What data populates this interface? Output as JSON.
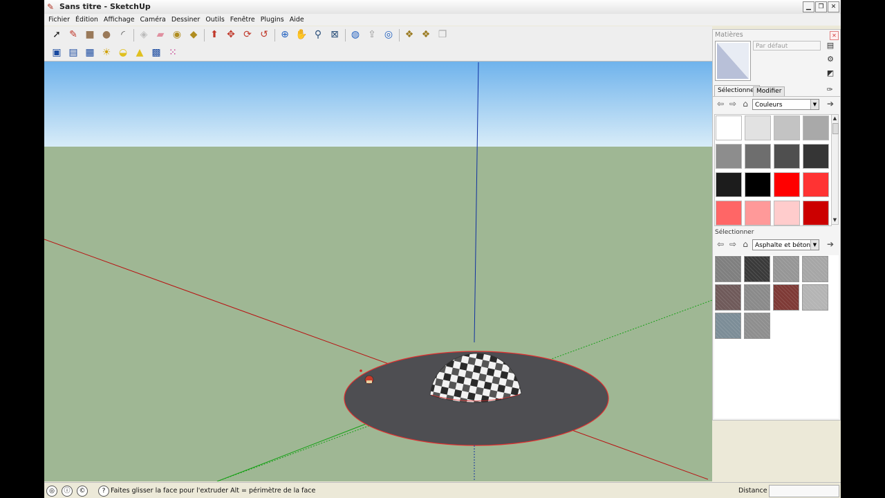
{
  "window": {
    "title": "Sans titre - SketchUp",
    "controls": [
      "minimize-icon",
      "maximize-icon",
      "close-icon"
    ]
  },
  "menu": [
    "Fichier",
    "Édition",
    "Affichage",
    "Caméra",
    "Dessiner",
    "Outils",
    "Fenêtre",
    "Plugins",
    "Aide"
  ],
  "toolbar1": [
    {
      "name": "select-tool-icon",
      "glyph": "➚",
      "color": "#222222"
    },
    {
      "name": "pencil-tool-icon",
      "glyph": "✎",
      "color": "#c0392b"
    },
    {
      "name": "rectangle-tool-icon",
      "glyph": "■",
      "color": "#9a7a5a"
    },
    {
      "name": "circle-tool-icon",
      "glyph": "●",
      "color": "#9a7a5a"
    },
    {
      "name": "arc-tool-icon",
      "glyph": "◜",
      "color": "#444444"
    },
    {
      "name": "make-component-icon",
      "glyph": "◈",
      "color": "#bbbbbb"
    },
    {
      "name": "eraser-tool-icon",
      "glyph": "▰",
      "color": "#e090a0"
    },
    {
      "name": "tape-measure-icon",
      "glyph": "◉",
      "color": "#b08d20"
    },
    {
      "name": "paint-bucket-icon",
      "glyph": "◆",
      "color": "#b08d20"
    },
    {
      "name": "push-pull-icon",
      "glyph": "⬆",
      "color": "#c0392b"
    },
    {
      "name": "move-tool-icon",
      "glyph": "✥",
      "color": "#c0392b"
    },
    {
      "name": "rotate-tool-icon",
      "glyph": "⟳",
      "color": "#c0392b"
    },
    {
      "name": "offset-tool-icon",
      "glyph": "↺",
      "color": "#c0392b"
    },
    {
      "name": "orbit-tool-icon",
      "glyph": "⊕",
      "color": "#2060c0"
    },
    {
      "name": "pan-tool-icon",
      "glyph": "✋",
      "color": "#555555"
    },
    {
      "name": "zoom-tool-icon",
      "glyph": "⚲",
      "color": "#2a4f7a"
    },
    {
      "name": "zoom-extents-icon",
      "glyph": "⊠",
      "color": "#2a4f7a"
    },
    {
      "name": "3d-warehouse-icon",
      "glyph": "◍",
      "color": "#2060c0"
    },
    {
      "name": "share-model-icon",
      "glyph": "⇪",
      "color": "#9a9a9a"
    },
    {
      "name": "get-models-icon",
      "glyph": "◎",
      "color": "#2060c0"
    },
    {
      "name": "component-icon",
      "glyph": "❖",
      "color": "#9a7a20"
    },
    {
      "name": "component-options-icon",
      "glyph": "❖",
      "color": "#9a7a20"
    },
    {
      "name": "share-component-icon",
      "glyph": "❐",
      "color": "#aaaaaa"
    }
  ],
  "toolbar2": [
    {
      "name": "layers-icon",
      "glyph": "▣",
      "color": "#1a4aa0"
    },
    {
      "name": "outliner-icon",
      "glyph": "▤",
      "color": "#1a4aa0"
    },
    {
      "name": "scenes-icon",
      "glyph": "▦",
      "color": "#1a4aa0"
    },
    {
      "name": "shadow-settings-icon",
      "glyph": "☀",
      "color": "#d0a000"
    },
    {
      "name": "shadows-toggle-icon",
      "glyph": "◒",
      "color": "#e0c020"
    },
    {
      "name": "fog-icon",
      "glyph": "▲",
      "color": "#e0c020"
    },
    {
      "name": "styles-icon",
      "glyph": "▩",
      "color": "#1a4aa0"
    },
    {
      "name": "materials-grid-icon",
      "glyph": "⁙",
      "color": "#c02080"
    }
  ],
  "materials_panel": {
    "title": "Matières",
    "name_placeholder": "Par défaut",
    "tab_select": "Sélectionner",
    "tab_edit": "Modifier",
    "library1": "Couleurs",
    "section2_label": "Sélectionner",
    "library2": "Asphalte et béton",
    "colors": [
      "#ffffff",
      "#e2e2e2",
      "#c3c3c3",
      "#a9a9a9",
      "#8d8d8d",
      "#6e6e6e",
      "#4f4f4f",
      "#353535",
      "#1c1c1c",
      "#000000",
      "#ff0000",
      "#ff3333",
      "#ff6666",
      "#ff9999",
      "#ffcccc",
      "#cc0000"
    ],
    "textures": [
      {
        "name": "texture-stone-pavers",
        "color": "#7f7f7f"
      },
      {
        "name": "texture-dark-asphalt",
        "color": "#3a3a3a"
      },
      {
        "name": "texture-grey-concrete",
        "color": "#969696"
      },
      {
        "name": "texture-light-concrete",
        "color": "#a6a6a6"
      },
      {
        "name": "texture-brick-paving",
        "color": "#6f5a5a"
      },
      {
        "name": "texture-concrete-block",
        "color": "#8a8a8a"
      },
      {
        "name": "texture-red-asphalt",
        "color": "#7e3a36"
      },
      {
        "name": "texture-smooth-concrete",
        "color": "#b4b4b4"
      },
      {
        "name": "texture-blue-grey-stone",
        "color": "#7c8d97"
      },
      {
        "name": "texture-ribbed-concrete",
        "color": "#8e8e8e"
      }
    ]
  },
  "status": {
    "hint": "Faites glisser la face pour l'extruder  Alt = périmètre de la face",
    "measurement_label": "Distance",
    "measurement_value": ""
  },
  "colors": {
    "sky_top": "#6fb3ec",
    "sky_bottom": "#d8ecf8",
    "ground": "#9fb794",
    "disc": "#4e4e52",
    "selection_edge": "#e03030",
    "axis_red": "#b81010",
    "axis_green": "#14a014",
    "axis_blue": "#1030a0"
  }
}
